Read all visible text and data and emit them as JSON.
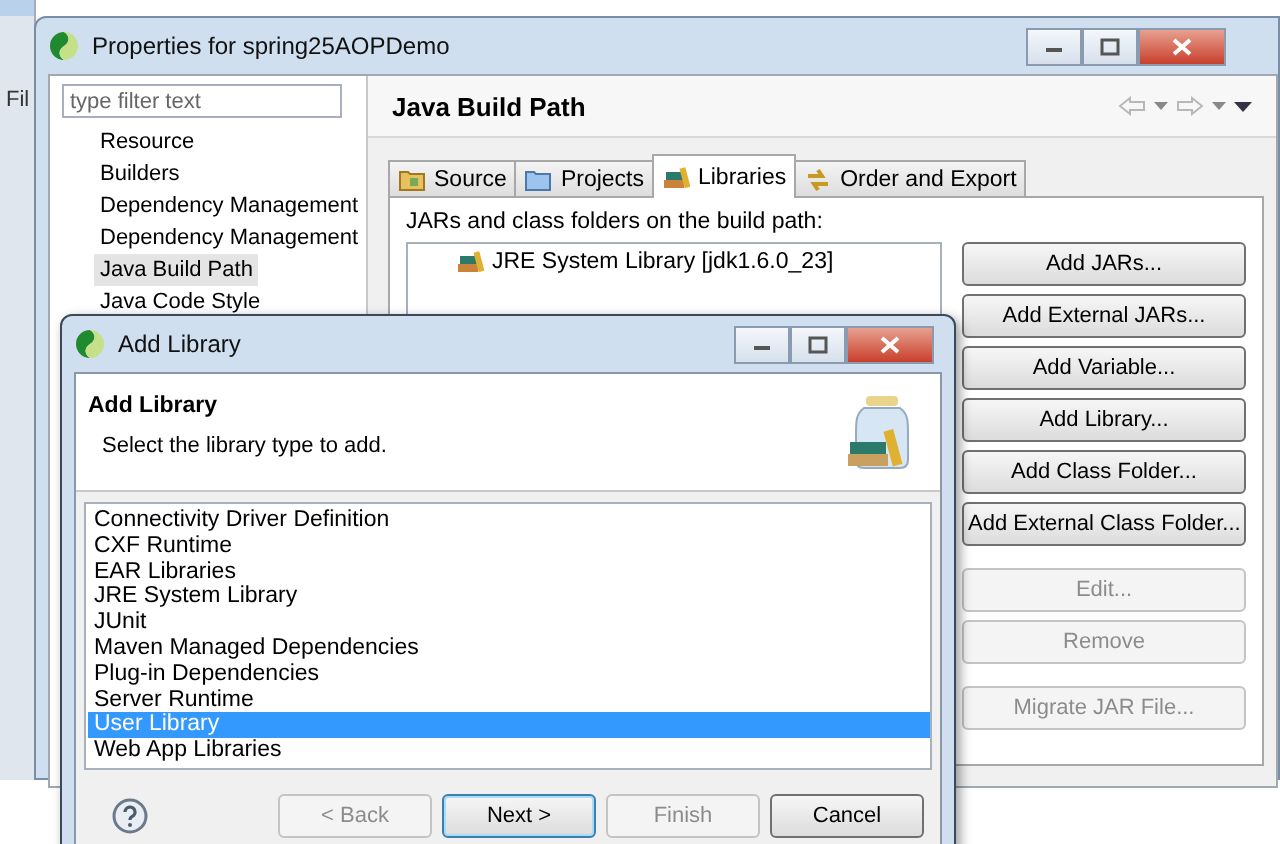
{
  "background_window": {
    "menu_label": "Fil"
  },
  "properties_window": {
    "title": "Properties for spring25AOPDemo",
    "filter": {
      "placeholder": "type filter text"
    },
    "tree_items": [
      {
        "label": "Resource",
        "selected": false
      },
      {
        "label": "Builders",
        "selected": false
      },
      {
        "label": "Dependency Management",
        "selected": false
      },
      {
        "label": "Dependency Management",
        "selected": false
      },
      {
        "label": "Java Build Path",
        "selected": true
      },
      {
        "label": "Java Code Style",
        "selected": false
      }
    ],
    "page_title": "Java Build Path",
    "tabs": [
      {
        "label": "Source",
        "kind": "source",
        "selected": false
      },
      {
        "label": "Projects",
        "kind": "projects",
        "selected": false
      },
      {
        "label": "Libraries",
        "kind": "libraries",
        "selected": true
      },
      {
        "label": "Order and Export",
        "kind": "order",
        "selected": false
      }
    ],
    "build_path_label": "JARs and class folders on the build path:",
    "entries": [
      {
        "label": "JRE System Library [jdk1.6.0_23]"
      }
    ],
    "button_groups": [
      [
        {
          "label": "Add JARs...",
          "disabled": false
        },
        {
          "label": "Add External JARs...",
          "disabled": false
        },
        {
          "label": "Add Variable...",
          "disabled": false
        },
        {
          "label": "Add Library...",
          "disabled": false
        },
        {
          "label": "Add Class Folder...",
          "disabled": false
        },
        {
          "label": "Add External Class Folder...",
          "disabled": false
        }
      ],
      [
        {
          "label": "Edit...",
          "disabled": true
        },
        {
          "label": "Remove",
          "disabled": true
        }
      ],
      [
        {
          "label": "Migrate JAR File...",
          "disabled": true
        }
      ]
    ]
  },
  "add_library_dialog": {
    "title": "Add Library",
    "heading": "Add Library",
    "description": "Select the library type to add.",
    "library_types": [
      {
        "label": "Connectivity Driver Definition",
        "selected": false
      },
      {
        "label": "CXF Runtime",
        "selected": false
      },
      {
        "label": "EAR Libraries",
        "selected": false
      },
      {
        "label": "JRE System Library",
        "selected": false
      },
      {
        "label": "JUnit",
        "selected": false
      },
      {
        "label": "Maven Managed Dependencies",
        "selected": false
      },
      {
        "label": "Plug-in Dependencies",
        "selected": false
      },
      {
        "label": "Server Runtime",
        "selected": false
      },
      {
        "label": "User Library",
        "selected": true
      },
      {
        "label": "Web App Libraries",
        "selected": false
      }
    ],
    "buttons": [
      {
        "label": "< Back",
        "disabled": true,
        "default": false
      },
      {
        "label": "Next >",
        "disabled": false,
        "default": true
      },
      {
        "label": "Finish",
        "disabled": true,
        "default": false
      },
      {
        "label": "Cancel",
        "disabled": false,
        "default": false
      }
    ]
  }
}
